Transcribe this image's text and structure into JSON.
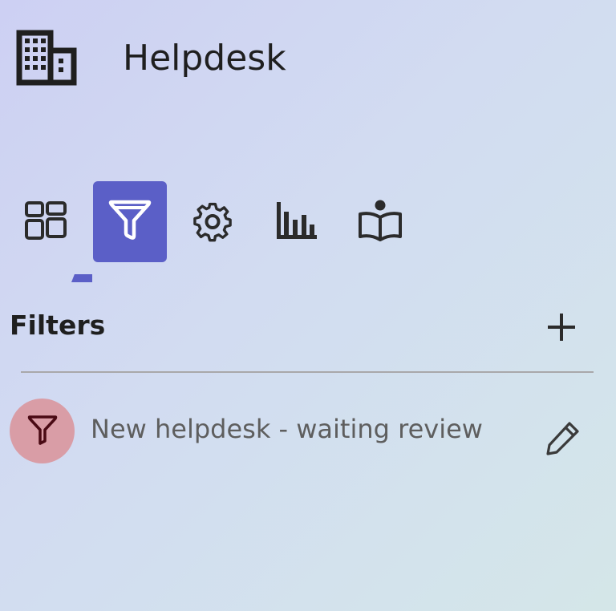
{
  "app": {
    "title": "Helpdesk",
    "icon": "building-icon"
  },
  "tabs": [
    {
      "name": "tab-dashboard",
      "icon": "dashboard-icon",
      "active": false
    },
    {
      "name": "tab-filters",
      "icon": "filter-icon",
      "active": true
    },
    {
      "name": "tab-settings",
      "icon": "gear-icon",
      "active": false
    },
    {
      "name": "tab-reports",
      "icon": "bar-chart-icon",
      "active": false
    },
    {
      "name": "tab-knowledge",
      "icon": "reading-book-icon",
      "active": false
    }
  ],
  "filters_section": {
    "title": "Filters",
    "add_icon": "plus-icon",
    "items": [
      {
        "label": "New helpdesk - waiting review",
        "icon": "filter-icon",
        "edit_icon": "pencil-icon"
      }
    ]
  },
  "colors": {
    "accent": "#5b5fc7",
    "filter_avatar_bg": "#d99da6",
    "filter_avatar_icon": "#4a0a14",
    "text_primary": "#1f1f1f",
    "text_secondary": "#5e5e5e"
  }
}
